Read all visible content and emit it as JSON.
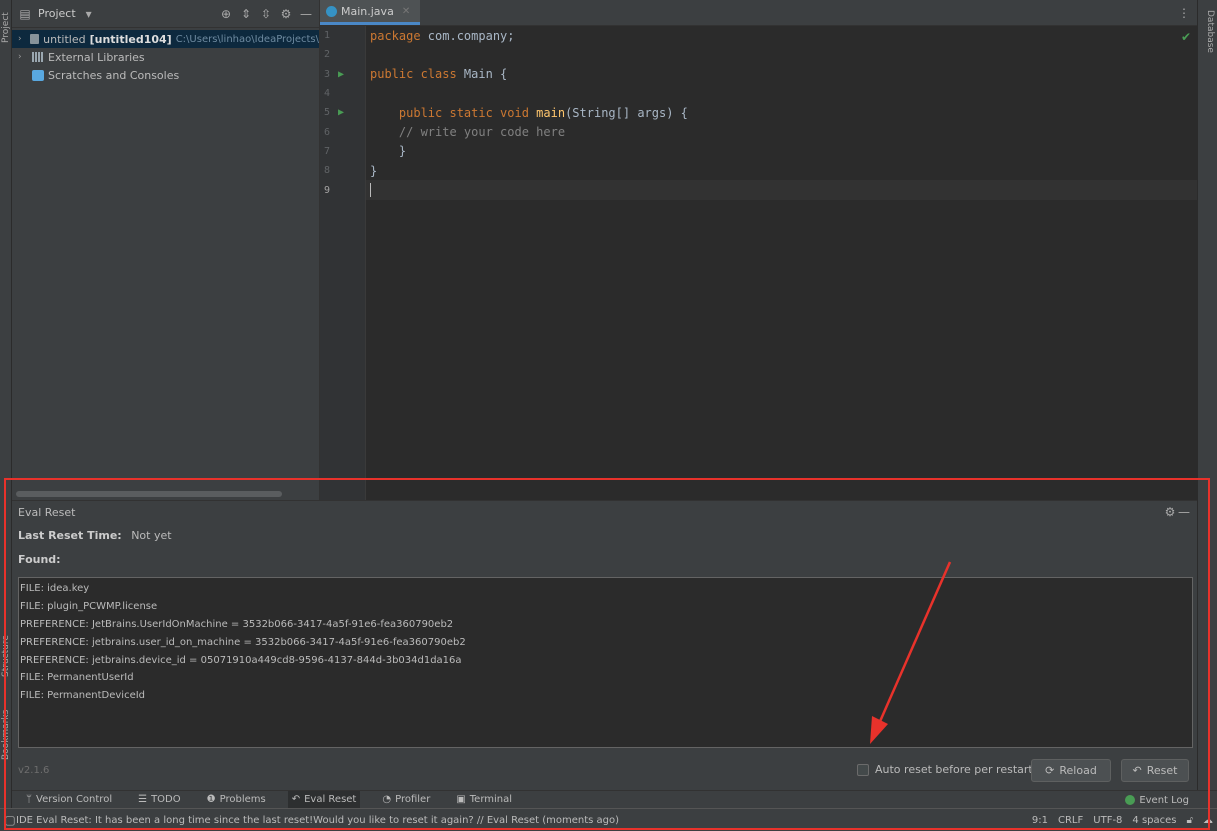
{
  "left_strip": {
    "project_tab": "Project",
    "structure_tab": "Structure",
    "bookmarks_tab": "Bookmarks"
  },
  "right_strip": {
    "database_tab": "Database"
  },
  "project_panel": {
    "title": "Project",
    "tree": [
      {
        "name": "untitled",
        "bold": "[untitled104]",
        "path": "C:\\Users\\linhao\\IdeaProjects\\"
      },
      {
        "name": "External Libraries"
      },
      {
        "name": "Scratches and Consoles"
      }
    ]
  },
  "editor": {
    "tab_label": "Main.java",
    "line_numbers": [
      "1",
      "2",
      "3",
      "4",
      "5",
      "6",
      "7",
      "8",
      "9"
    ],
    "code": {
      "l1_kw": "package",
      "l1_rest": " com.company;",
      "l3_kw": "public class",
      "l3_rest": " Main {",
      "l5_kw": "    public static void",
      "l5_fn": " main",
      "l5_rest": "(String[] args) {",
      "l6": "    // write your code here",
      "l7": "    }",
      "l8": "}"
    }
  },
  "eval_reset": {
    "title": "Eval Reset",
    "last_reset_label": "Last Reset Time:",
    "last_reset_value": "Not yet",
    "found_label": "Found:",
    "found_items": [
      "FILE: idea.key",
      "FILE: plugin_PCWMP.license",
      "PREFERENCE: JetBrains.UserIdOnMachine = 3532b066-3417-4a5f-91e6-fea360790eb2",
      "PREFERENCE: jetbrains.user_id_on_machine = 3532b066-3417-4a5f-91e6-fea360790eb2",
      "PREFERENCE: jetbrains.device_id = 05071910a449cd8-9596-4137-844d-3b034d1da16a",
      "FILE: PermanentUserId",
      "FILE: PermanentDeviceId"
    ],
    "version": "v2.1.6",
    "auto_reset_label": "Auto reset before per restart",
    "reload_label": "Reload",
    "reset_label": "Reset"
  },
  "bottom_tabs": {
    "version_control": "Version Control",
    "todo": "TODO",
    "problems": "Problems",
    "eval_reset": "Eval Reset",
    "profiler": "Profiler",
    "terminal": "Terminal",
    "event_log": "Event Log"
  },
  "status_bar": {
    "message": "IDE Eval Reset: It has been a long time since the last reset!Would you like to reset it again? // Eval Reset (moments ago)",
    "position": "9:1",
    "line_sep": "CRLF",
    "encoding": "UTF-8",
    "indent": "4 spaces"
  },
  "colors": {
    "annotation": "#e8322b",
    "accent": "#4a88c7",
    "run": "#499c54"
  }
}
